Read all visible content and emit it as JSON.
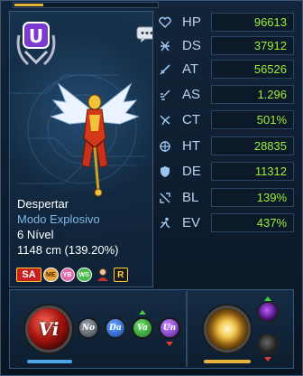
{
  "top_bar": {
    "progress_fraction": 0.2
  },
  "character": {
    "status_line": "Despertar",
    "mode": "Modo Explosivo",
    "level": "6 Nível",
    "height": "1148 cm (139.20%)"
  },
  "tags": [
    {
      "id": "sa",
      "label": "SA"
    },
    {
      "id": "me",
      "label": "ME"
    },
    {
      "id": "yb",
      "label": "YB"
    },
    {
      "id": "ws",
      "label": "WS"
    },
    {
      "id": "avatar",
      "label": ""
    },
    {
      "id": "r",
      "label": "R"
    }
  ],
  "stats": [
    {
      "name": "HP",
      "value": "96613",
      "icon": "heart-icon"
    },
    {
      "name": "DS",
      "value": "37912",
      "icon": "crossed-lines-icon"
    },
    {
      "name": "AT",
      "value": "56526",
      "icon": "sword-icon"
    },
    {
      "name": "AS",
      "value": "1.296",
      "icon": "swift-blade-icon"
    },
    {
      "name": "CT",
      "value": "501%",
      "icon": "critical-burst-icon"
    },
    {
      "name": "HT",
      "value": "28835",
      "icon": "crosshair-icon"
    },
    {
      "name": "DE",
      "value": "11312",
      "icon": "shield-icon"
    },
    {
      "name": "BL",
      "value": "139%",
      "icon": "block-icon"
    },
    {
      "name": "EV",
      "value": "437%",
      "icon": "evade-runner-icon"
    }
  ],
  "attributes": {
    "main": "Vi",
    "secondary": [
      "No",
      "Da",
      "Va",
      "Un"
    ]
  },
  "colors": {
    "stat_value": "#9cf03a",
    "stat_name": "#b9d3ec",
    "mode_text": "#7fb8e8"
  }
}
